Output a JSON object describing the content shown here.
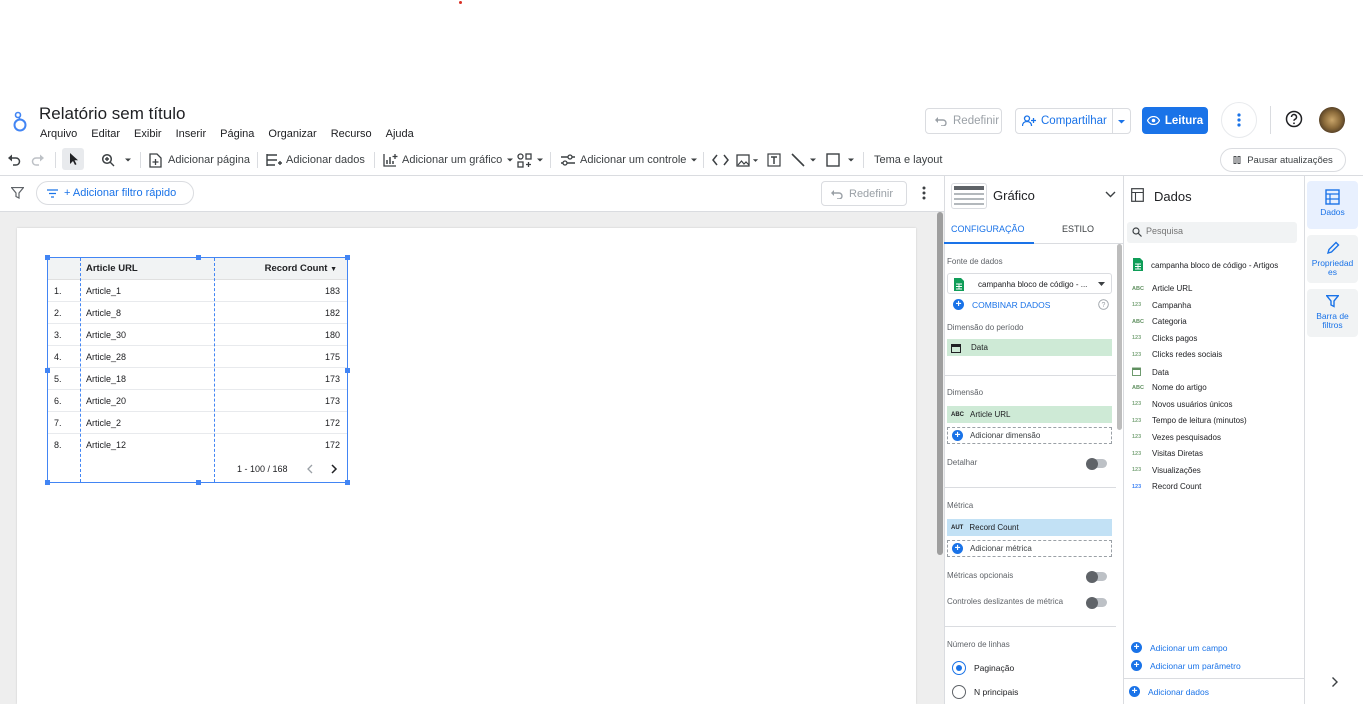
{
  "header": {
    "title": "Relatório sem título",
    "menu": [
      "Arquivo",
      "Editar",
      "Exibir",
      "Inserir",
      "Página",
      "Organizar",
      "Recurso",
      "Ajuda"
    ],
    "redefinir_label": "Redefinir",
    "share_label": "Compartilhar",
    "leitura_label": "Leitura"
  },
  "toolbar": {
    "add_page": "Adicionar página",
    "add_data": "Adicionar dados",
    "add_chart": "Adicionar um gráfico",
    "add_control": "Adicionar um controle",
    "theme_layout": "Tema e layout",
    "pause_updates": "Pausar atualizações"
  },
  "filterbar": {
    "quick_filter": "+ Adicionar filtro rápido",
    "redefinir_label": "Redefinir"
  },
  "table": {
    "col_url": "Article URL",
    "col_count": "Record Count",
    "rows": [
      {
        "n": "1.",
        "url": "Article_1",
        "v": "183"
      },
      {
        "n": "2.",
        "url": "Article_8",
        "v": "182"
      },
      {
        "n": "3.",
        "url": "Article_30",
        "v": "180"
      },
      {
        "n": "4.",
        "url": "Article_28",
        "v": "175"
      },
      {
        "n": "5.",
        "url": "Article_18",
        "v": "173"
      },
      {
        "n": "6.",
        "url": "Article_20",
        "v": "173"
      },
      {
        "n": "7.",
        "url": "Article_2",
        "v": "172"
      },
      {
        "n": "8.",
        "url": "Article_12",
        "v": "172"
      }
    ],
    "pagination": "1 - 100 / 168"
  },
  "config": {
    "chart_type": "Gráfico",
    "tab_config": "CONFIGURAÇÃO",
    "tab_style": "ESTILO",
    "data_source_label": "Fonte de dados",
    "data_source": "campanha bloco de código - ...",
    "blend": "COMBINAR DADOS",
    "period_label": "Dimensão do período",
    "period_field": "Data",
    "dimension_label": "Dimensão",
    "dimension_field": "Article URL",
    "dimension_type": "ABC",
    "add_dimension": "Adicionar dimensão",
    "drill": "Detalhar",
    "metric_label": "Métrica",
    "metric_field": "Record Count",
    "metric_type": "AUT",
    "add_metric": "Adicionar métrica",
    "optional_metrics": "Métricas opcionais",
    "metric_sliders": "Controles deslizantes de métrica",
    "rows_label": "Número de linhas",
    "pagination_opt": "Paginação",
    "top_n_opt": "N principais"
  },
  "data_panel": {
    "title": "Dados",
    "search_placeholder": "Pesquisa",
    "source": "campanha bloco de código - Artigos",
    "fields": [
      {
        "type": "ABC",
        "name": "Article URL"
      },
      {
        "type": "123",
        "name": "Campanha"
      },
      {
        "type": "ABC",
        "name": "Categoria"
      },
      {
        "type": "123",
        "name": "Clicks pagos"
      },
      {
        "type": "123",
        "name": "Clicks redes sociais"
      },
      {
        "type": "cal",
        "name": "Data"
      },
      {
        "type": "ABC",
        "name": "Nome do artigo"
      },
      {
        "type": "123",
        "name": "Novos usuários únicos"
      },
      {
        "type": "123",
        "name": "Tempo de leitura (minutos)"
      },
      {
        "type": "123",
        "name": "Vezes pesquisados"
      },
      {
        "type": "123",
        "name": "Visitas Diretas"
      },
      {
        "type": "123",
        "name": "Visualizações"
      },
      {
        "type": "123",
        "name": "Record Count"
      }
    ],
    "add_field": "Adicionar um campo",
    "add_param": "Adicionar um parâmetro",
    "add_data": "Adicionar dados"
  },
  "rail": {
    "dados": "Dados",
    "propriedades": "Propriedad es",
    "filtros": "Barra de filtros"
  },
  "colors": {
    "accent": "#1a73e8",
    "chip_green": "#ceead6",
    "chip_blue": "#c2e1f5"
  }
}
